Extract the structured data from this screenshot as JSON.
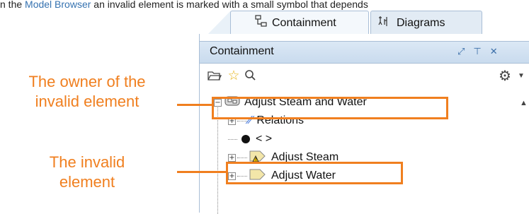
{
  "intro": {
    "prefix": "n the ",
    "link": "Model Browser",
    "suffix": " an invalid element is marked with a small symbol that depends"
  },
  "tabs": [
    {
      "label": "Containment",
      "icon": "containment-icon",
      "active": true
    },
    {
      "label": "Diagrams",
      "icon": "diagrams-icon",
      "active": false
    }
  ],
  "panel": {
    "title": "Containment",
    "header_icons": [
      "restore-icon",
      "pin-icon",
      "close-icon"
    ],
    "toolbar_icons": [
      "open-folder-icon",
      "star-icon",
      "search-icon",
      "gear-icon"
    ]
  },
  "tree": {
    "items": [
      {
        "label": "Adjust Steam and Water",
        "icon": "activity-icon",
        "expander": "−"
      },
      {
        "label": "Relations",
        "icon": "relation-icon",
        "expander": "+"
      },
      {
        "label": "< >",
        "icon": "node-icon",
        "expander": ""
      },
      {
        "label": "Adjust Steam",
        "icon": "action-warning-icon",
        "expander": "+"
      },
      {
        "label": "Adjust Water",
        "icon": "action-icon",
        "expander": "+"
      }
    ]
  },
  "callouts": {
    "owner": "The owner of the invalid element",
    "owner_line1": "The owner of the",
    "owner_line2": "invalid element",
    "invalid_line1": "The invalid",
    "invalid_line2": "element"
  },
  "colors": {
    "accent": "#f07f1f",
    "panel_header": "#d3e2f2",
    "link": "#3572b0"
  }
}
